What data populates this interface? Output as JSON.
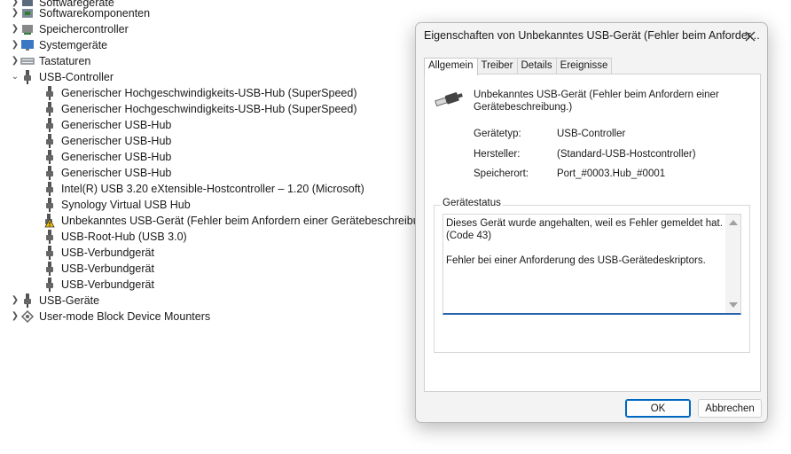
{
  "tree": {
    "items": [
      {
        "label": "Softwaregeräte",
        "icon": "software-device-icon"
      },
      {
        "label": "Softwarekomponenten",
        "icon": "software-component-icon"
      },
      {
        "label": "Speichercontroller",
        "icon": "storage-controller-icon"
      },
      {
        "label": "Systemgeräte",
        "icon": "system-device-icon"
      },
      {
        "label": "Tastaturen",
        "icon": "keyboard-icon"
      },
      {
        "label": "USB-Controller",
        "icon": "usb-icon"
      },
      {
        "label": "Generischer Hochgeschwindigkeits-USB-Hub (SuperSpeed)",
        "icon": "usb-icon"
      },
      {
        "label": "Generischer Hochgeschwindigkeits-USB-Hub (SuperSpeed)",
        "icon": "usb-icon"
      },
      {
        "label": "Generischer USB-Hub",
        "icon": "usb-icon"
      },
      {
        "label": "Generischer USB-Hub",
        "icon": "usb-icon"
      },
      {
        "label": "Generischer USB-Hub",
        "icon": "usb-icon"
      },
      {
        "label": "Generischer USB-Hub",
        "icon": "usb-icon"
      },
      {
        "label": "Intel(R) USB 3.20 eXtensible-Hostcontroller – 1.20 (Microsoft)",
        "icon": "usb-icon"
      },
      {
        "label": "Synology Virtual USB Hub",
        "icon": "usb-icon"
      },
      {
        "label": "Unbekanntes USB-Gerät (Fehler beim Anfordern einer Gerätebeschreibung.)",
        "icon": "usb-warning-icon"
      },
      {
        "label": "USB-Root-Hub (USB 3.0)",
        "icon": "usb-icon"
      },
      {
        "label": "USB-Verbundgerät",
        "icon": "usb-icon"
      },
      {
        "label": "USB-Verbundgerät",
        "icon": "usb-icon"
      },
      {
        "label": "USB-Verbundgerät",
        "icon": "usb-icon"
      },
      {
        "label": "USB-Geräte",
        "icon": "usb-icon"
      },
      {
        "label": "User-mode Block Device Mounters",
        "icon": "block-device-icon"
      }
    ]
  },
  "dialog": {
    "title": "Eigenschaften von Unbekanntes USB-Gerät (Fehler beim Anforder...",
    "tabs": [
      "Allgemein",
      "Treiber",
      "Details",
      "Ereignisse"
    ],
    "device_name": "Unbekanntes USB-Gerät (Fehler beim Anfordern einer Gerätebeschreibung.)",
    "props": [
      {
        "label": "Gerätetyp:",
        "value": "USB-Controller"
      },
      {
        "label": "Hersteller:",
        "value": "(Standard-USB-Hostcontroller)"
      },
      {
        "label": "Speicherort:",
        "value": "Port_#0003.Hub_#0001"
      }
    ],
    "status_group_title": "Gerätestatus",
    "status_text": "Dieses Gerät wurde angehalten, weil es Fehler gemeldet hat.\n(Code 43)\n\nFehler bei einer Anforderung des USB-Gerätedeskriptors.",
    "ok_label": "OK",
    "cancel_label": "Abbrechen"
  }
}
